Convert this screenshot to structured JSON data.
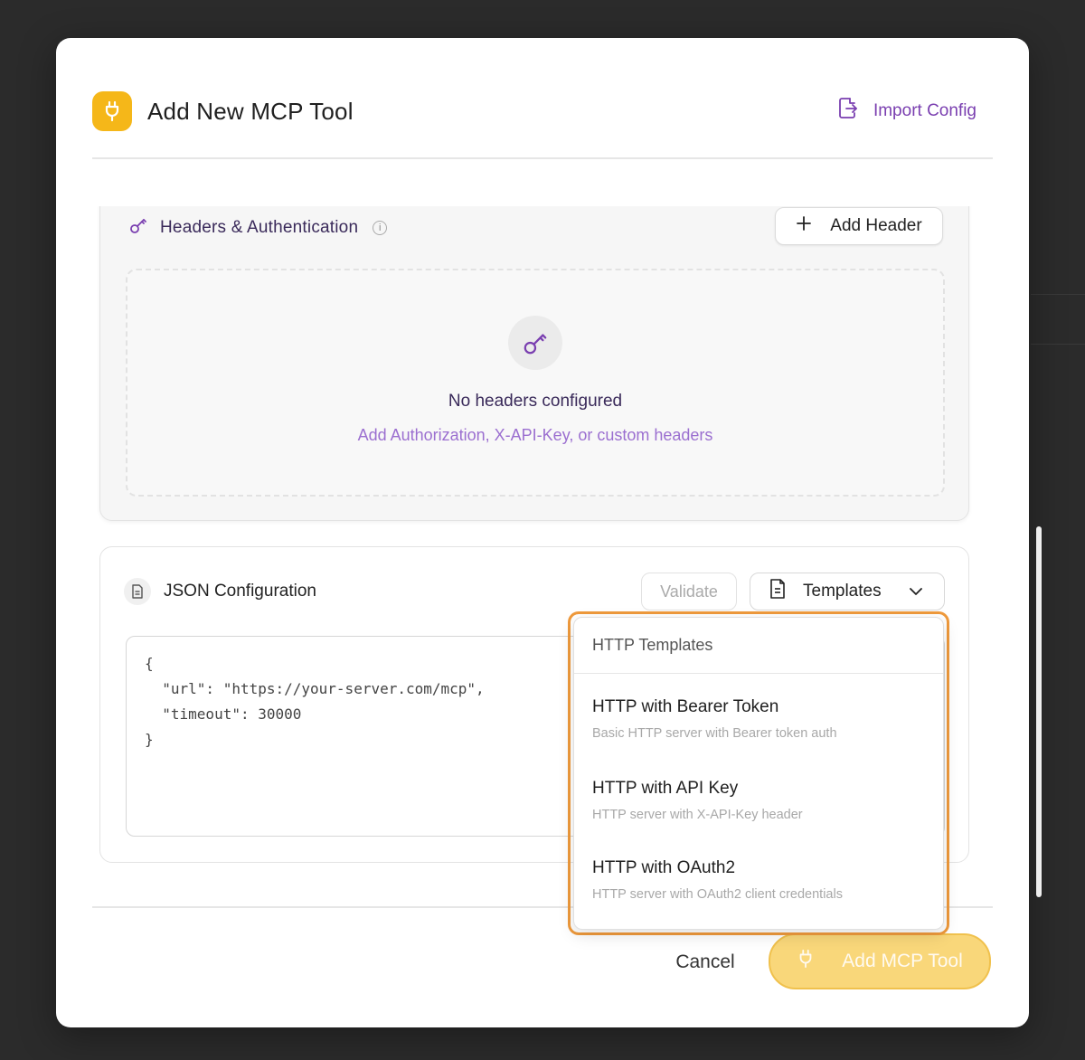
{
  "modal": {
    "title": "Add New MCP Tool",
    "import_label": "Import Config"
  },
  "headers_section": {
    "title": "Headers & Authentication",
    "info_glyph": "i",
    "add_header_label": "Add Header",
    "empty_title": "No headers configured",
    "empty_subtitle": "Add Authorization, X-API-Key, or custom headers"
  },
  "json_section": {
    "title": "JSON Configuration",
    "validate_label": "Validate",
    "templates_label": "Templates",
    "code": {
      "open": "{",
      "url_line": "  \"url\": \"https://your-server.com/mcp\",",
      "timeout_line": "  \"timeout\": 30000",
      "close": "}"
    }
  },
  "templates_dropdown": {
    "header": "HTTP Templates",
    "items": [
      {
        "title": "HTTP with Bearer Token",
        "subtitle": "Basic HTTP server with Bearer token auth"
      },
      {
        "title": "HTTP with API Key",
        "subtitle": "HTTP server with X-API-Key header"
      },
      {
        "title": "HTTP with OAuth2",
        "subtitle": "HTTP server with OAuth2 client credentials"
      }
    ]
  },
  "footer": {
    "cancel_label": "Cancel",
    "submit_label": "Add MCP Tool"
  },
  "colors": {
    "accent_purple": "#7a3fb0",
    "brand_yellow": "#f5b719",
    "highlight_orange": "#ef9a3c"
  },
  "icons": {
    "badge": "plug-icon",
    "import": "import-file-icon",
    "headers": "key-icon",
    "add": "plus-icon",
    "json": "document-icon",
    "templates": "document-icon",
    "dropdown": "chevron-down-icon"
  }
}
